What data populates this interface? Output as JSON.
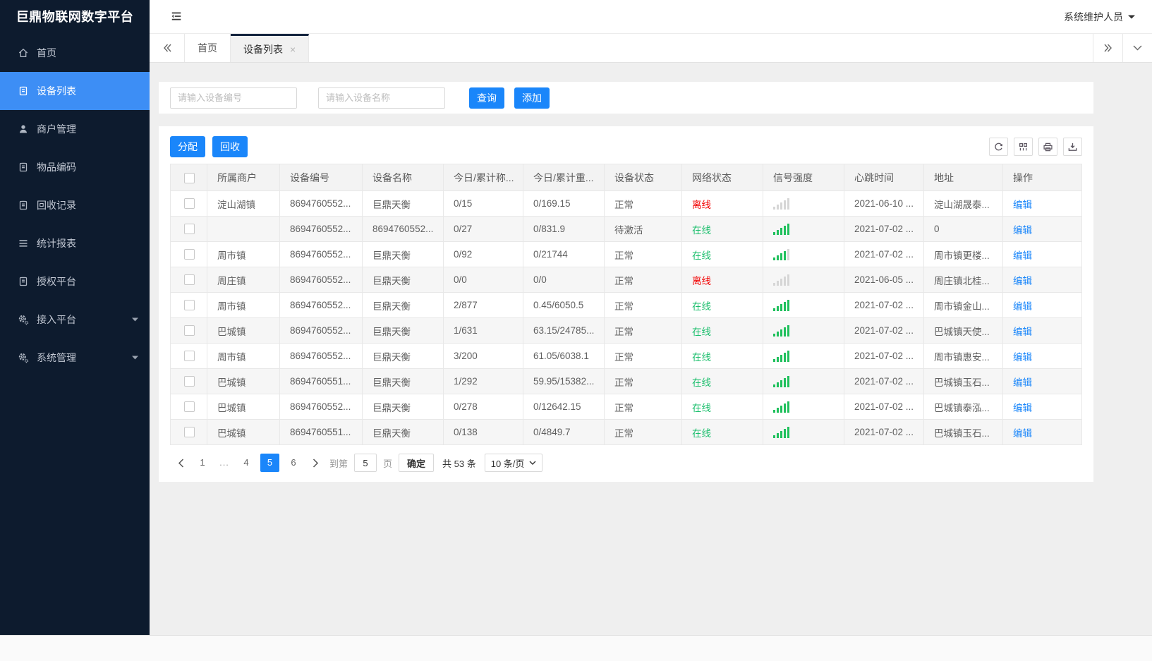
{
  "app": {
    "title": "巨鼎物联网数字平台",
    "user": "系统维护人员"
  },
  "colors": {
    "primary": "#1a86fa",
    "sidebar_bg": "#0d1b2e",
    "sidebar_active": "#3d8ef5",
    "online": "#19be6b",
    "offline": "#f20000",
    "link": "#1a86fa",
    "signal_on": "#1fc05c"
  },
  "sidebar": {
    "items": [
      {
        "label": "首页",
        "icon": "home-icon"
      },
      {
        "label": "设备列表",
        "icon": "device-list-icon",
        "active": true
      },
      {
        "label": "商户管理",
        "icon": "merchant-icon"
      },
      {
        "label": "物品编码",
        "icon": "item-code-icon"
      },
      {
        "label": "回收记录",
        "icon": "recycle-record-icon"
      },
      {
        "label": "统计报表",
        "icon": "report-icon"
      },
      {
        "label": "授权平台",
        "icon": "authorize-icon"
      },
      {
        "label": "接入平台",
        "icon": "access-platform-icon",
        "expandable": true
      },
      {
        "label": "系统管理",
        "icon": "system-manage-icon",
        "expandable": true
      }
    ]
  },
  "tabs": {
    "items": [
      {
        "label": "首页"
      },
      {
        "label": "设备列表",
        "active": true,
        "closable": true
      }
    ]
  },
  "search": {
    "device_no_placeholder": "请输入设备编号",
    "device_name_placeholder": "请输入设备名称",
    "query_label": "查询",
    "add_label": "添加"
  },
  "toolbar": {
    "assign_label": "分配",
    "recycle_label": "回收",
    "icons": [
      "refresh-icon",
      "columns-icon",
      "print-icon",
      "export-icon"
    ]
  },
  "table": {
    "columns": [
      "所属商户",
      "设备编号",
      "设备名称",
      "今日/累计称...",
      "今日/累计重...",
      "设备状态",
      "网络状态",
      "信号强度",
      "心跳时间",
      "地址",
      "操作"
    ],
    "edit_label": "编辑",
    "rows": [
      {
        "merchant": "淀山湖镇",
        "device_no": "8694760552...",
        "device_name": "巨鼎天衡",
        "today_count": "0/15",
        "today_weight": "0/169.15",
        "device_status": "正常",
        "network_status": "离线",
        "online": false,
        "signal_bars": 0,
        "heartbeat": "2021-06-10 ...",
        "address": "淀山湖晟泰..."
      },
      {
        "merchant": "",
        "device_no": "8694760552...",
        "device_name": "8694760552...",
        "today_count": "0/27",
        "today_weight": "0/831.9",
        "device_status": "待激活",
        "network_status": "在线",
        "online": true,
        "signal_bars": 5,
        "heartbeat": "2021-07-02 ...",
        "address": "0"
      },
      {
        "merchant": "周市镇",
        "device_no": "8694760552...",
        "device_name": "巨鼎天衡",
        "today_count": "0/92",
        "today_weight": "0/21744",
        "device_status": "正常",
        "network_status": "在线",
        "online": true,
        "signal_bars": 4,
        "heartbeat": "2021-07-02 ...",
        "address": "周市镇更楼..."
      },
      {
        "merchant": "周庄镇",
        "device_no": "8694760552...",
        "device_name": "巨鼎天衡",
        "today_count": "0/0",
        "today_weight": "0/0",
        "device_status": "正常",
        "network_status": "离线",
        "online": false,
        "signal_bars": 0,
        "heartbeat": "2021-06-05 ...",
        "address": "周庄镇北桂..."
      },
      {
        "merchant": "周市镇",
        "device_no": "8694760552...",
        "device_name": "巨鼎天衡",
        "today_count": "2/877",
        "today_weight": "0.45/6050.5",
        "device_status": "正常",
        "network_status": "在线",
        "online": true,
        "signal_bars": 5,
        "heartbeat": "2021-07-02 ...",
        "address": "周市镇金山..."
      },
      {
        "merchant": "巴城镇",
        "device_no": "8694760552...",
        "device_name": "巨鼎天衡",
        "today_count": "1/631",
        "today_weight": "63.15/24785...",
        "device_status": "正常",
        "network_status": "在线",
        "online": true,
        "signal_bars": 5,
        "heartbeat": "2021-07-02 ...",
        "address": "巴城镇天使..."
      },
      {
        "merchant": "周市镇",
        "device_no": "8694760552...",
        "device_name": "巨鼎天衡",
        "today_count": "3/200",
        "today_weight": "61.05/6038.1",
        "device_status": "正常",
        "network_status": "在线",
        "online": true,
        "signal_bars": 5,
        "heartbeat": "2021-07-02 ...",
        "address": "周市镇惠安..."
      },
      {
        "merchant": "巴城镇",
        "device_no": "8694760551...",
        "device_name": "巨鼎天衡",
        "today_count": "1/292",
        "today_weight": "59.95/15382...",
        "device_status": "正常",
        "network_status": "在线",
        "online": true,
        "signal_bars": 5,
        "heartbeat": "2021-07-02 ...",
        "address": "巴城镇玉石..."
      },
      {
        "merchant": "巴城镇",
        "device_no": "8694760552...",
        "device_name": "巨鼎天衡",
        "today_count": "0/278",
        "today_weight": "0/12642.15",
        "device_status": "正常",
        "network_status": "在线",
        "online": true,
        "signal_bars": 5,
        "heartbeat": "2021-07-02 ...",
        "address": "巴城镇泰泓..."
      },
      {
        "merchant": "巴城镇",
        "device_no": "8694760551...",
        "device_name": "巨鼎天衡",
        "today_count": "0/138",
        "today_weight": "0/4849.7",
        "device_status": "正常",
        "network_status": "在线",
        "online": true,
        "signal_bars": 5,
        "heartbeat": "2021-07-02 ...",
        "address": "巴城镇玉石..."
      }
    ]
  },
  "pagination": {
    "pages": [
      "1",
      "...",
      "4",
      "5",
      "6"
    ],
    "active_page": "5",
    "goto_label": "到第",
    "goto_value": "5",
    "page_unit": "页",
    "confirm_label": "确定",
    "total_label": "共 53 条",
    "page_size": "10 条/页"
  }
}
